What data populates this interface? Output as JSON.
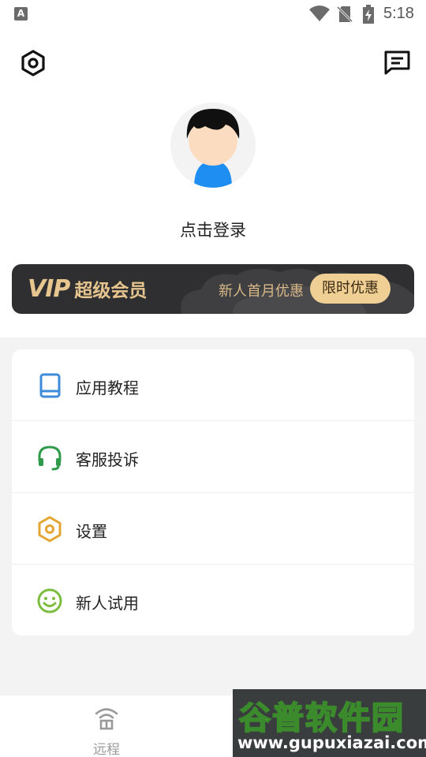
{
  "status_bar": {
    "app_icon_letter": "A",
    "time": "5:18",
    "icons": [
      "wifi-icon",
      "no-sim-icon",
      "battery-charging-icon"
    ]
  },
  "header": {
    "settings_icon": "settings-hex-icon",
    "message_icon": "message-icon"
  },
  "profile": {
    "login_text": "点击登录"
  },
  "vip_banner": {
    "logo_text": "VIP",
    "title": "超级会员",
    "promo_text": "新人首月优惠",
    "button_label": "限时优惠",
    "accent_color": "#e7c58e",
    "pill_color": "#f0cf95"
  },
  "menu": {
    "items": [
      {
        "label": "应用教程",
        "icon": "book-icon",
        "color": "#3d8bd9"
      },
      {
        "label": "客服投诉",
        "icon": "headset-icon",
        "color": "#2e9a4a"
      },
      {
        "label": "设置",
        "icon": "settings-hex-icon",
        "color": "#e4a532"
      },
      {
        "label": "新人试用",
        "icon": "smile-icon",
        "color": "#7cbd3f"
      }
    ]
  },
  "bottom_nav": {
    "remote_label": "远程"
  },
  "watermark": {
    "title": "谷普软件园",
    "url": "www.gupuxiazai.com"
  }
}
